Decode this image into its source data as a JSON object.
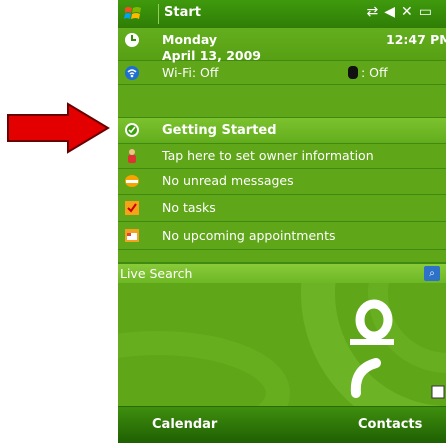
{
  "titlebar": {
    "title": "Start",
    "status_icons": [
      "connectivity-icon",
      "speaker-muted-icon",
      "battery-icon"
    ]
  },
  "today": {
    "day": "Monday",
    "date": "April 13, 2009",
    "time": "12:47 PM"
  },
  "connectivity": {
    "wifi_label": "Wi-Fi: Off",
    "bluetooth_label": ": Off"
  },
  "items": [
    {
      "label": "Getting Started",
      "icon": "getting-started-icon"
    },
    {
      "label": "Tap here to set owner information",
      "icon": "owner-icon"
    },
    {
      "label": "No unread messages",
      "icon": "messages-icon"
    },
    {
      "label": "No tasks",
      "icon": "tasks-icon"
    },
    {
      "label": "No upcoming appointments",
      "icon": "calendar-icon"
    }
  ],
  "search": {
    "label": "Live Search"
  },
  "softkeys": {
    "left": "Calendar",
    "right": "Contacts"
  },
  "colors": {
    "accent": "#5fa619",
    "highlight_arrow": "#e00000"
  }
}
